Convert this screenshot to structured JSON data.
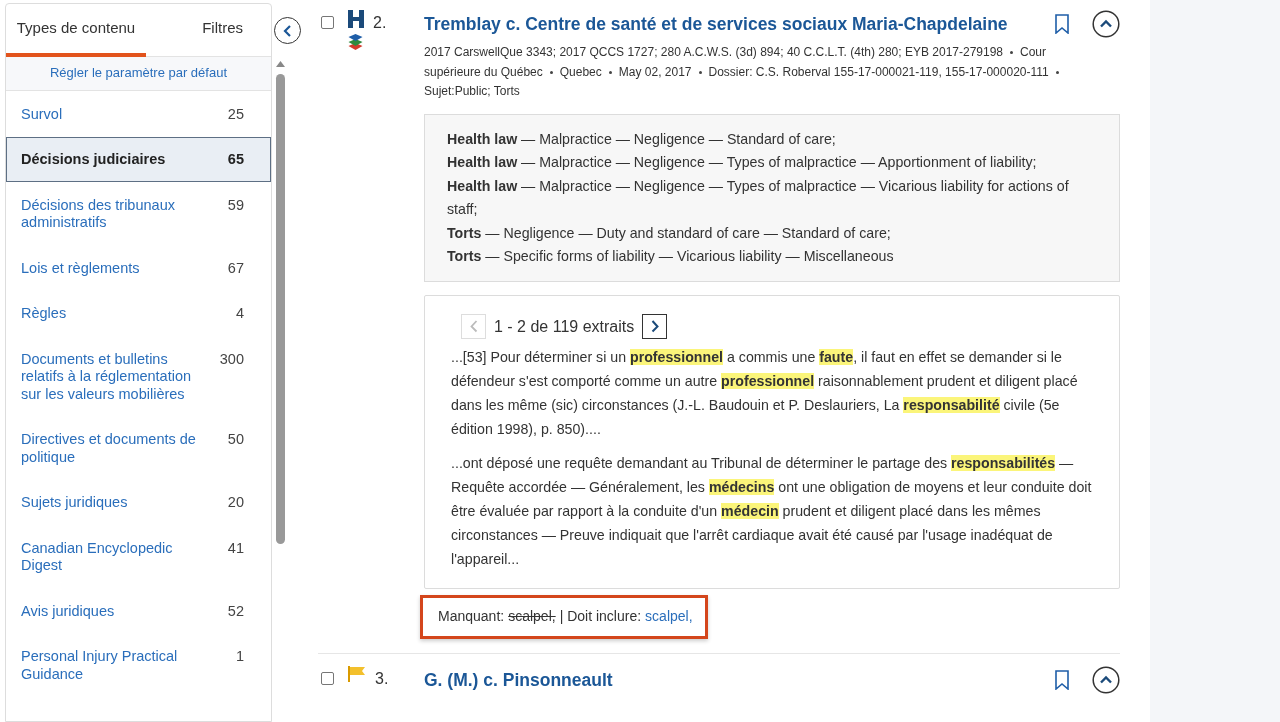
{
  "sidebar": {
    "tabs": [
      {
        "label": "Types de contenu",
        "selected": true
      },
      {
        "label": "Filtres",
        "selected": false
      }
    ],
    "reset_link": "Régler le paramètre par défaut",
    "items": [
      {
        "label": "Survol",
        "count": "25",
        "selected": false
      },
      {
        "label": "Décisions judiciaires",
        "count": "65",
        "selected": true
      },
      {
        "label": "Décisions des tribunaux administratifs",
        "count": "59",
        "selected": false
      },
      {
        "label": "Lois et règlements",
        "count": "67",
        "selected": false
      },
      {
        "label": "Règles",
        "count": "4",
        "selected": false
      },
      {
        "label": "Documents et bulletins relatifs à la réglementation sur les valeurs mobilières",
        "count": "300",
        "selected": false
      },
      {
        "label": "Directives et documents de politique",
        "count": "50",
        "selected": false
      },
      {
        "label": "Sujets juridiques",
        "count": "20",
        "selected": false
      },
      {
        "label": "Canadian Encyclopedic Digest",
        "count": "41",
        "selected": false
      },
      {
        "label": "Avis juridiques",
        "count": "52",
        "selected": false
      },
      {
        "label": "Personal Injury Practical Guidance",
        "count": "1",
        "selected": false
      }
    ]
  },
  "results": [
    {
      "checked": false,
      "markers": [
        {
          "kind": "h"
        },
        {
          "kind": "layers"
        }
      ],
      "number": "2.",
      "title": "Tremblay c. Centre de santé et de services sociaux Maria-Chapdelaine",
      "meta": [
        "2017 CarswellQue 3343; 2017 QCCS 1727; 280 A.C.W.S. (3d) 894; 40 C.C.L.T. (4th) 280; EYB 2017-279198",
        "Cour supérieure du Québec",
        "Quebec",
        "May 02, 2017",
        "Dossier: C.S. Roberval 155-17-000021-119, 155-17-000020-111",
        "Sujet:Public; Torts"
      ],
      "headnotes": [
        "**Health law** — Malpractice — Negligence — Standard of care;",
        "**Health law** — Malpractice — Negligence — Types of malpractice — Apportionment of liability;",
        "**Health law** — Malpractice — Negligence — Types of malpractice — Vicarious liability for actions of staff;",
        "**Torts** — Negligence — Duty and standard of care — Standard of care;",
        "**Torts** — Specific forms of liability — Vicarious liability — Miscellaneous"
      ],
      "excerpts": {
        "pager": "1 - 2 de 119 extraits",
        "prev_disabled": true,
        "next_disabled": false,
        "items": [
          "...[53] Pour déterminer si un **professionnel** a commis une **faute**, il faut en effet se demander si le défendeur s'est comporté comme un autre **professionnel** raisonnablement prudent et diligent placé dans les même (sic) circonstances (J.-L. Baudouin et P. Deslauriers, La **responsabilité** civile (5e édition 1998), p. 850)....",
          "...ont déposé une requête demandant au Tribunal de déterminer le partage des **responsabilités** — Requête accordée — Généralement, les **médecins** ont une obligation de moyens et leur conduite doit être évaluée par rapport à la conduite d'un **médecin** prudent et diligent placé dans les mêmes circonstances — Preuve indiquait que l'arrêt cardiaque avait été causé par l'usage inadéquat de l'appareil..."
        ]
      },
      "terms": {
        "missing_label": "Manquant:",
        "missing_term": "scalpel,",
        "include_label": "| Doit inclure:",
        "include_term": "scalpel,"
      }
    },
    {
      "checked": false,
      "markers": [
        {
          "kind": "flag"
        }
      ],
      "number": "3.",
      "title": "G. (M.) c. Pinsonneault"
    }
  ]
}
